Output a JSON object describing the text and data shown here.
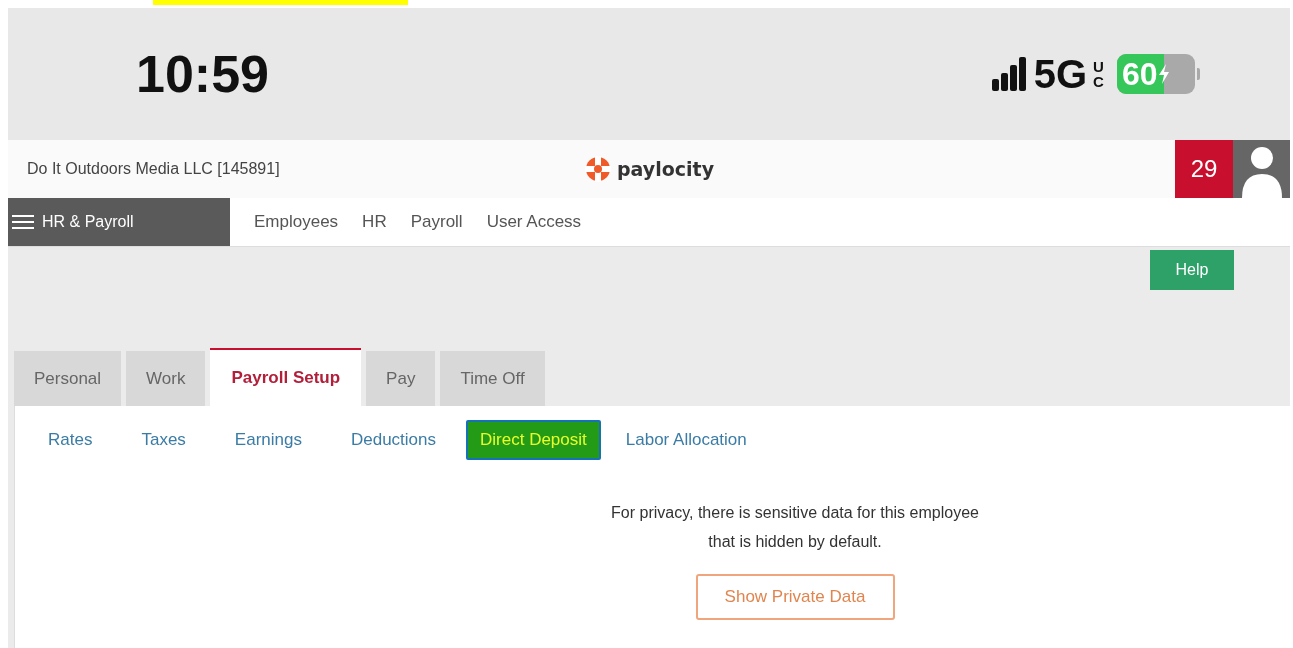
{
  "status_bar": {
    "time": "10:59",
    "network": "5G",
    "network_suffix": "UC",
    "battery": "60",
    "charging": true
  },
  "header": {
    "company": "Do It Outdoors Media LLC [145891]",
    "logo_text": "paylocity",
    "notification_count": "29"
  },
  "nav": {
    "menu_label": "HR & Payroll",
    "links": [
      "Employees",
      "HR",
      "Payroll",
      "User Access"
    ]
  },
  "help_button": "Help",
  "tabs": [
    {
      "label": "Personal",
      "selected": false
    },
    {
      "label": "Work",
      "selected": false
    },
    {
      "label": "Payroll Setup",
      "selected": true
    },
    {
      "label": "Pay",
      "selected": false
    },
    {
      "label": "Time Off",
      "selected": false
    }
  ],
  "subtabs": [
    {
      "label": "Rates",
      "selected": false
    },
    {
      "label": "Taxes",
      "selected": false
    },
    {
      "label": "Earnings",
      "selected": false
    },
    {
      "label": "Deductions",
      "selected": false
    },
    {
      "label": "Direct Deposit",
      "selected": true
    },
    {
      "label": "Labor Allocation",
      "selected": false
    }
  ],
  "privacy_notice": {
    "lines": [
      "For privacy, there is sensitive data for this employee",
      "that is hidden by default."
    ],
    "button": "Show Private Data"
  }
}
